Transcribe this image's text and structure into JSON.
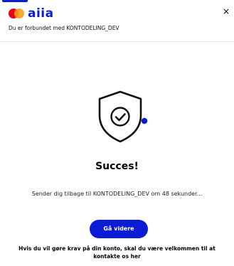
{
  "header": {
    "logo_text": "aiia",
    "close_label": "×",
    "connected_text": "Du er forbundet med KONTODELING_DEV"
  },
  "main": {
    "title": "Succes!",
    "redirect_text": "Sender dig tilbage til KONTODELING_DEV om 48 sekunder...",
    "continue_button": "Gå videre",
    "contact_line1": "Hvis du vil gøre krav på din konto, skal du være velkommen til at",
    "contact_line2": "kontakte os her"
  },
  "icons": {
    "logo": "aiia-logo-icon",
    "close": "close-icon",
    "shield": "shield-check-icon"
  },
  "colors": {
    "brand": "#0a1cd4",
    "logo_red": "#eb001b",
    "logo_orange": "#f79e1b",
    "text": "#000000",
    "divider": "#e6e6e6"
  }
}
